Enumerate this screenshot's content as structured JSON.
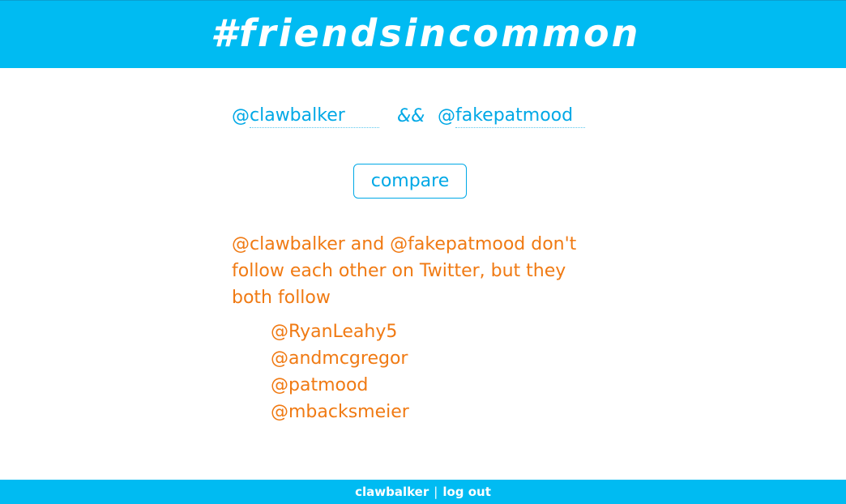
{
  "header": {
    "title": "#friendsincommon"
  },
  "form": {
    "at_symbol": "@",
    "user1": "clawbalker",
    "connector": "&&",
    "user2": "fakepatmood",
    "compare_label": "compare"
  },
  "result": {
    "message": "@clawbalker and @fakepatmood don't follow each other on Twitter, but they both follow",
    "common_follows": [
      "@RyanLeahy5",
      "@andmcgregor",
      "@patmood",
      "@mbacksmeier"
    ]
  },
  "footer": {
    "username": "clawbalker",
    "separator": "|",
    "logout_label": "log out"
  },
  "colors": {
    "brand": "#00bbf2",
    "accent_blue": "#00a8e6",
    "result_orange": "#f07a13"
  }
}
